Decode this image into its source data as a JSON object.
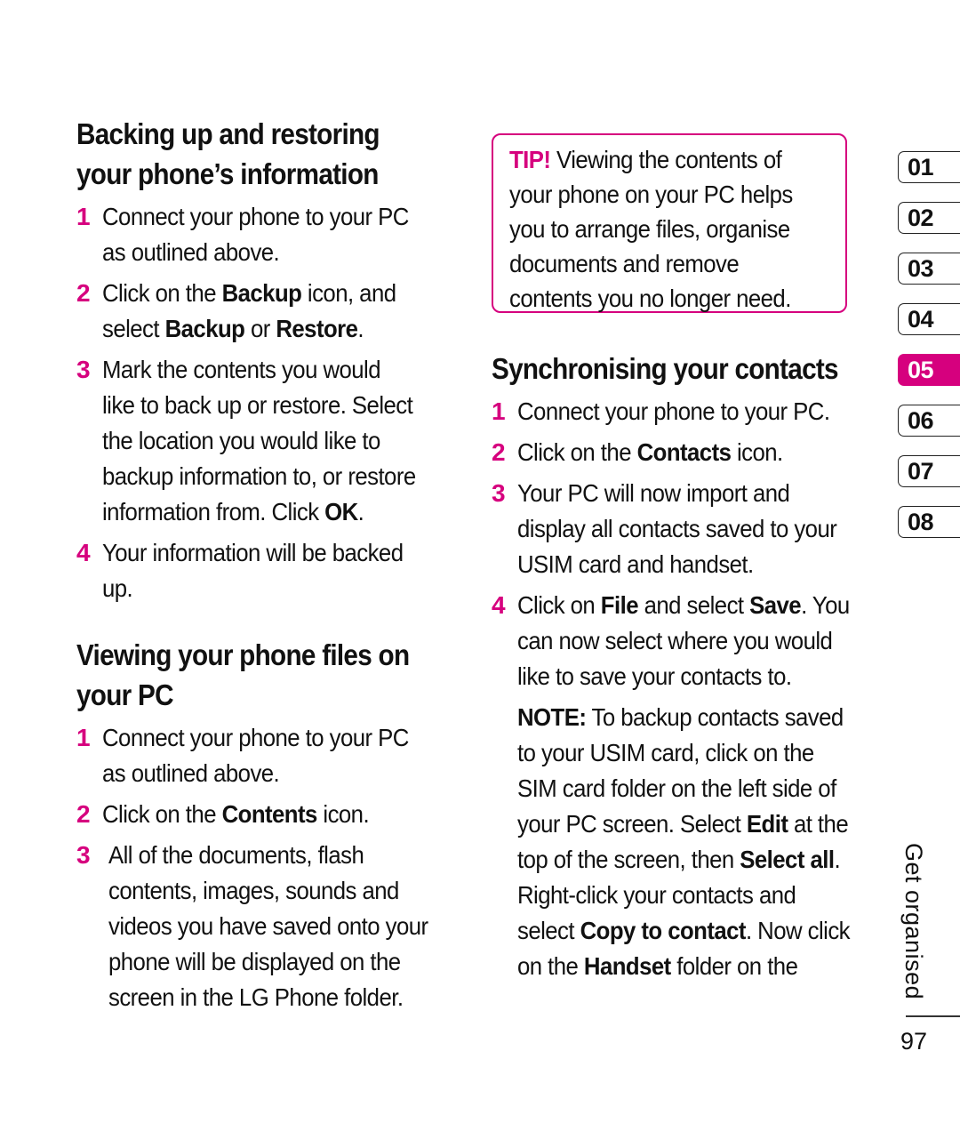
{
  "accent_color": "#d6007e",
  "left": {
    "backup": {
      "heading_line1": "Backing up and restoring",
      "heading_line2": "your phone’s information",
      "steps": [
        {
          "num": "1",
          "lines": [
            "Connect your phone to your PC",
            "as outlined above."
          ]
        },
        {
          "num": "2",
          "line1_a": "Click on the ",
          "line1_b": "Backup",
          "line1_c": " icon, and",
          "line2_a": "select ",
          "line2_b": "Backup",
          "line2_c": " or ",
          "line2_d": "Restore",
          "line2_e": "."
        },
        {
          "num": "3",
          "lines": [
            "Mark the contents you would",
            "like to back up or restore. Select",
            "the location you would like to",
            "backup information to, or restore"
          ],
          "last_a": "information from. Click ",
          "last_b": "OK",
          "last_c": "."
        },
        {
          "num": "4",
          "lines": [
            "Your information will be backed",
            "up."
          ]
        }
      ]
    },
    "viewing": {
      "heading_line1": "Viewing your phone files on",
      "heading_line2": "your PC",
      "steps": [
        {
          "num": "1",
          "lines": [
            "Connect your phone to your PC",
            "as outlined above."
          ]
        },
        {
          "num": "2",
          "a": "Click on the ",
          "b": "Contents",
          "c": " icon."
        },
        {
          "num": "3",
          "lines": [
            "All of the documents, flash",
            "contents, images, sounds and",
            "videos you have saved onto your",
            "phone will be displayed on the",
            "screen in the LG Phone folder."
          ]
        }
      ]
    }
  },
  "middle": {
    "tip": {
      "label": "TIP!",
      "first": " Viewing the contents of",
      "lines": [
        "your phone on your PC helps",
        "you to arrange files, organise",
        "documents and remove",
        "contents you no longer need."
      ]
    },
    "sync": {
      "heading": "Synchronising your contacts",
      "steps": [
        {
          "num": "1",
          "text": "Connect your phone to your PC."
        },
        {
          "num": "2",
          "a": "Click on the ",
          "b": "Contacts",
          "c": " icon."
        },
        {
          "num": "3",
          "lines": [
            "Your PC will now import and",
            "display all contacts saved to your",
            "USIM card and handset."
          ]
        },
        {
          "num": "4",
          "a": "Click on ",
          "b": "File",
          "c": " and select ",
          "d": "Save",
          "e": ". You",
          "lines": [
            "can now select where you would",
            "like to save your contacts to."
          ]
        }
      ],
      "note": {
        "label": "NOTE:",
        "first": " To backup contacts saved",
        "l2": "to your USIM card, click on the",
        "l3": "SIM card folder on the left side of",
        "l4_a": "your PC screen. Select ",
        "l4_b": "Edit",
        "l4_c": " at the",
        "l5_a": "top of the screen, then ",
        "l5_b": "Select all",
        "l5_c": ".",
        "l6": "Right-click your contacts and",
        "l7_a": "select ",
        "l7_b": "Copy to contact",
        "l7_c": ". Now click",
        "l8_a": "on the ",
        "l8_b": "Handset",
        "l8_c": " folder on the"
      }
    }
  },
  "chapter_tabs": [
    {
      "label": "01",
      "active": false
    },
    {
      "label": "02",
      "active": false
    },
    {
      "label": "03",
      "active": false
    },
    {
      "label": "04",
      "active": false
    },
    {
      "label": "05",
      "active": true
    },
    {
      "label": "06",
      "active": false
    },
    {
      "label": "07",
      "active": false
    },
    {
      "label": "08",
      "active": false
    }
  ],
  "section_label": "Get organised",
  "page_number": "97"
}
